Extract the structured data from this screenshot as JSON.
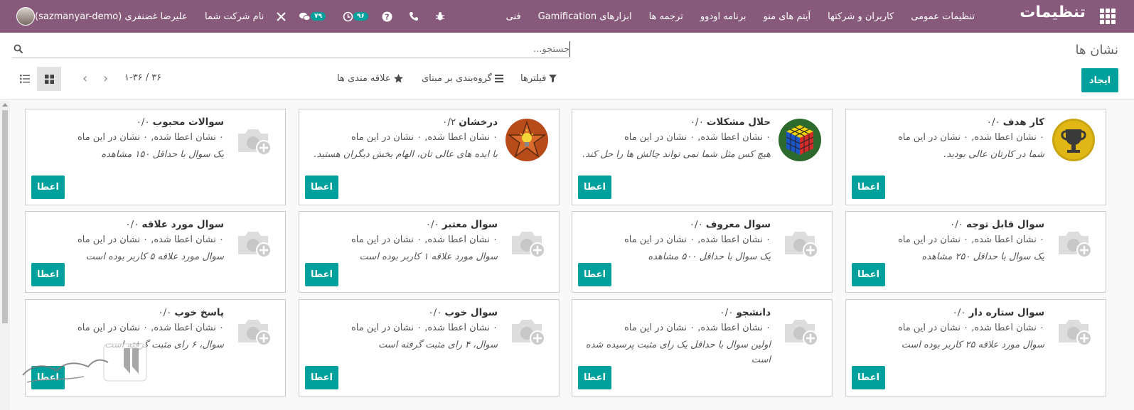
{
  "navbar": {
    "brand": "تنظیمات",
    "menu": [
      "تنظیمات عمومی",
      "کاربران و شرکتها",
      "آیتم های منو",
      "برنامه اودوو",
      "ترجمه ها",
      "ابزارهای Gamification",
      "فنی"
    ],
    "company": "نام شرکت شما",
    "messages_count": "۷۹",
    "activities_count": "۹۶",
    "user": "علیرضا غضنفری (sazmanyar-demo)"
  },
  "control_panel": {
    "title": "نشان ها",
    "search_placeholder": "جستجو...",
    "create_label": "ایجاد",
    "filters_label": "فیلترها",
    "groupby_label": "گروه‌بندی بر مبنای",
    "favorites_label": "علاقه مندی ها",
    "pager": "۱-۳۶ / ۳۶"
  },
  "badges": [
    {
      "name": "کار هدف",
      "count": "۰/۰",
      "stats": "۰ نشان اعطا شده, ۰ نشان در این ماه",
      "desc": "شما در کارتان عالی بودید.",
      "image": "trophy"
    },
    {
      "name": "حلال مشکلات",
      "count": "۰/۰",
      "stats": "۰ نشان اعطا شده, ۰ نشان در این ماه",
      "desc": "هیچ کس مثل شما نمی تواند چالش ها را حل کند.",
      "image": "rubik"
    },
    {
      "name": "درخشان",
      "count": "۰/۲",
      "stats": "۰ نشان اعطا شده, ۰ نشان در این ماه",
      "desc": "با ایده های عالی تان، الهام بخش دیگران هستید.",
      "image": "bulb"
    },
    {
      "name": "سوالات محبوب",
      "count": "۰/۰",
      "stats": "۰ نشان اعطا شده, ۰ نشان در این ماه",
      "desc": "یک سوال با حداقل ۱۵۰ مشاهده",
      "image": "placeholder"
    },
    {
      "name": "سوال قابل توجه",
      "count": "۰/۰",
      "stats": "۰ نشان اعطا شده, ۰ نشان در این ماه",
      "desc": "یک سوال با حداقل ۲۵۰ مشاهده",
      "image": "placeholder"
    },
    {
      "name": "سوال معروف",
      "count": "۰/۰",
      "stats": "۰ نشان اعطا شده, ۰ نشان در این ماه",
      "desc": "یک سوال با حداقل ۵۰۰ مشاهده",
      "image": "placeholder"
    },
    {
      "name": "سوال معتبر",
      "count": "۰/۰",
      "stats": "۰ نشان اعطا شده, ۰ نشان در این ماه",
      "desc": "سوال مورد علاقه ۱ کاربر بوده است",
      "image": "placeholder"
    },
    {
      "name": "سوال مورد علاقه",
      "count": "۰/۰",
      "stats": "۰ نشان اعطا شده, ۰ نشان در این ماه",
      "desc": "سوال مورد علاقه ۵ کاربر بوده است",
      "image": "placeholder"
    },
    {
      "name": "سوال ستاره دار",
      "count": "۰/۰",
      "stats": "۰ نشان اعطا شده, ۰ نشان در این ماه",
      "desc": "سوال مورد علاقه ۲۵ کاربر بوده است",
      "image": "placeholder"
    },
    {
      "name": "دانشجو",
      "count": "۰/۰",
      "stats": "۰ نشان اعطا شده, ۰ نشان در این ماه",
      "desc": "اولین سوال با حداقل یک رای مثبت پرسیده شده است",
      "image": "placeholder"
    },
    {
      "name": "سوال خوب",
      "count": "۰/۰",
      "stats": "۰ نشان اعطا شده, ۰ نشان در این ماه",
      "desc": "سوال، ۴ رای مثبت گرفته است",
      "image": "placeholder"
    },
    {
      "name": "پاسخ خوب",
      "count": "۰/۰",
      "stats": "۰ نشان اعطا شده, ۰ نشان در این ماه",
      "desc": "سوال، ۶ رای مثبت گرفته است",
      "image": "placeholder"
    }
  ],
  "grant_label": "اعطا"
}
